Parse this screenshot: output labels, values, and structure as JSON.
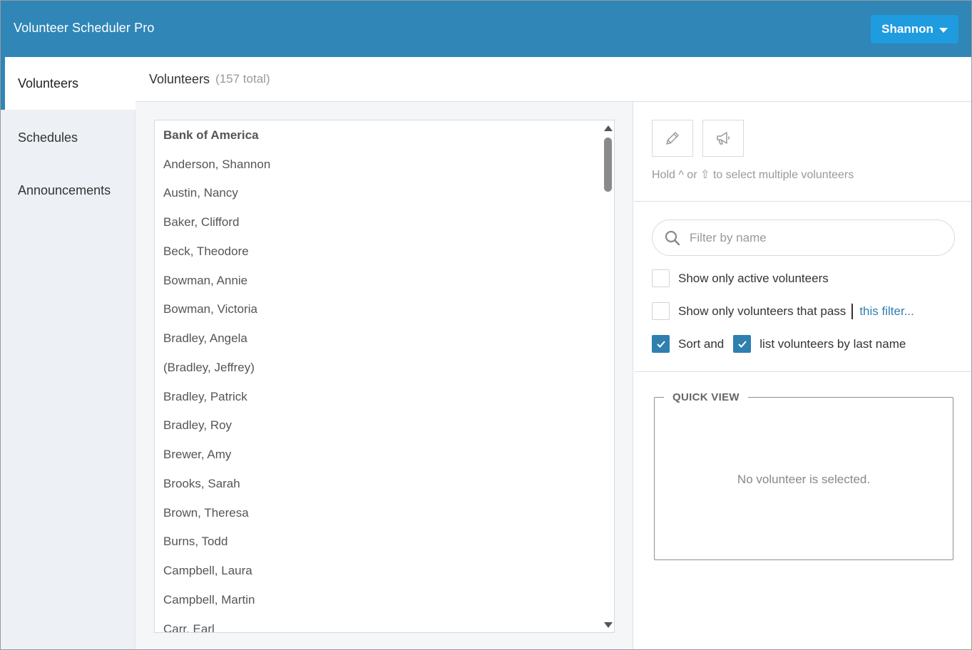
{
  "app": {
    "title": "Volunteer Scheduler Pro",
    "user_menu_label": "Shannon",
    "accent_color": "#2f86b7"
  },
  "sidebar": {
    "items": [
      {
        "label": "Volunteers",
        "active": true
      },
      {
        "label": "Schedules",
        "active": false
      },
      {
        "label": "Announcements",
        "active": false
      }
    ]
  },
  "header": {
    "title": "Volunteers",
    "count": "(157 total)"
  },
  "volunteer_list": {
    "items": [
      {
        "label": "Bank of America",
        "group": true
      },
      {
        "label": "Anderson, Shannon",
        "group": false
      },
      {
        "label": "Austin, Nancy",
        "group": false
      },
      {
        "label": "Baker, Clifford",
        "group": false
      },
      {
        "label": "Beck, Theodore",
        "group": false
      },
      {
        "label": "Bowman, Annie",
        "group": false
      },
      {
        "label": "Bowman, Victoria",
        "group": false
      },
      {
        "label": "Bradley, Angela",
        "group": false
      },
      {
        "label": "(Bradley, Jeffrey)",
        "group": false
      },
      {
        "label": "Bradley, Patrick",
        "group": false
      },
      {
        "label": "Bradley, Roy",
        "group": false
      },
      {
        "label": "Brewer, Amy",
        "group": false
      },
      {
        "label": "Brooks, Sarah",
        "group": false
      },
      {
        "label": "Brown, Theresa",
        "group": false
      },
      {
        "label": "Burns, Todd",
        "group": false
      },
      {
        "label": "Campbell, Laura",
        "group": false
      },
      {
        "label": "Campbell, Martin",
        "group": false
      },
      {
        "label": "Carr, Earl",
        "group": false
      }
    ]
  },
  "tools": {
    "edit_icon": "pencil-icon",
    "announce_icon": "megaphone-icon",
    "hint": "Hold ^ or ⇧ to select multiple volunteers"
  },
  "filters": {
    "search_placeholder": "Filter by name",
    "search_value": "",
    "active_only": {
      "label": "Show only active volunteers",
      "checked": false
    },
    "pass_filter": {
      "label": "Show only volunteers that pass",
      "link": "this filter...",
      "checked": false
    },
    "sort_last_name": {
      "label": "Sort and",
      "checked": true
    },
    "list_last_name": {
      "label": "list volunteers by last name",
      "checked": true
    }
  },
  "quick_view": {
    "title": "QUICK VIEW",
    "empty_text": "No volunteer is selected."
  }
}
